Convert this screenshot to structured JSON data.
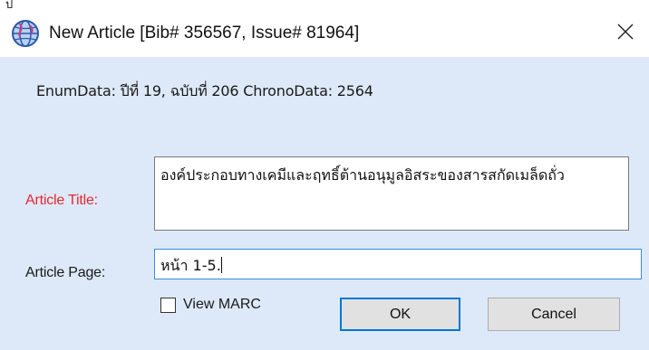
{
  "top_fragment": "ป",
  "window": {
    "title": "New Article [Bib# 356567, Issue# 81964]",
    "app_icon": "globe-icon",
    "close_icon": "close-icon"
  },
  "info": {
    "enum_line": "EnumData: ปีที่ 19, ฉบับที่ 206 ChronoData: 2564"
  },
  "form": {
    "title_label": "Article Title:",
    "title_value": "องค์ประกอบทางเคมีและฤทธิ์ต้านอนุมูลอิสระของสารสกัดเมล็ดถั่ว",
    "page_label": "Article Page:",
    "page_value": "หน้า 1-5."
  },
  "options": {
    "view_marc_label": "View MARC",
    "view_marc_checked": false
  },
  "buttons": {
    "ok_label": "OK",
    "cancel_label": "Cancel"
  },
  "colors": {
    "client_bg": "#dde9f8",
    "required_label": "#e8282e",
    "focus_border": "#3c8ae0",
    "default_button_border": "#0078d7"
  }
}
